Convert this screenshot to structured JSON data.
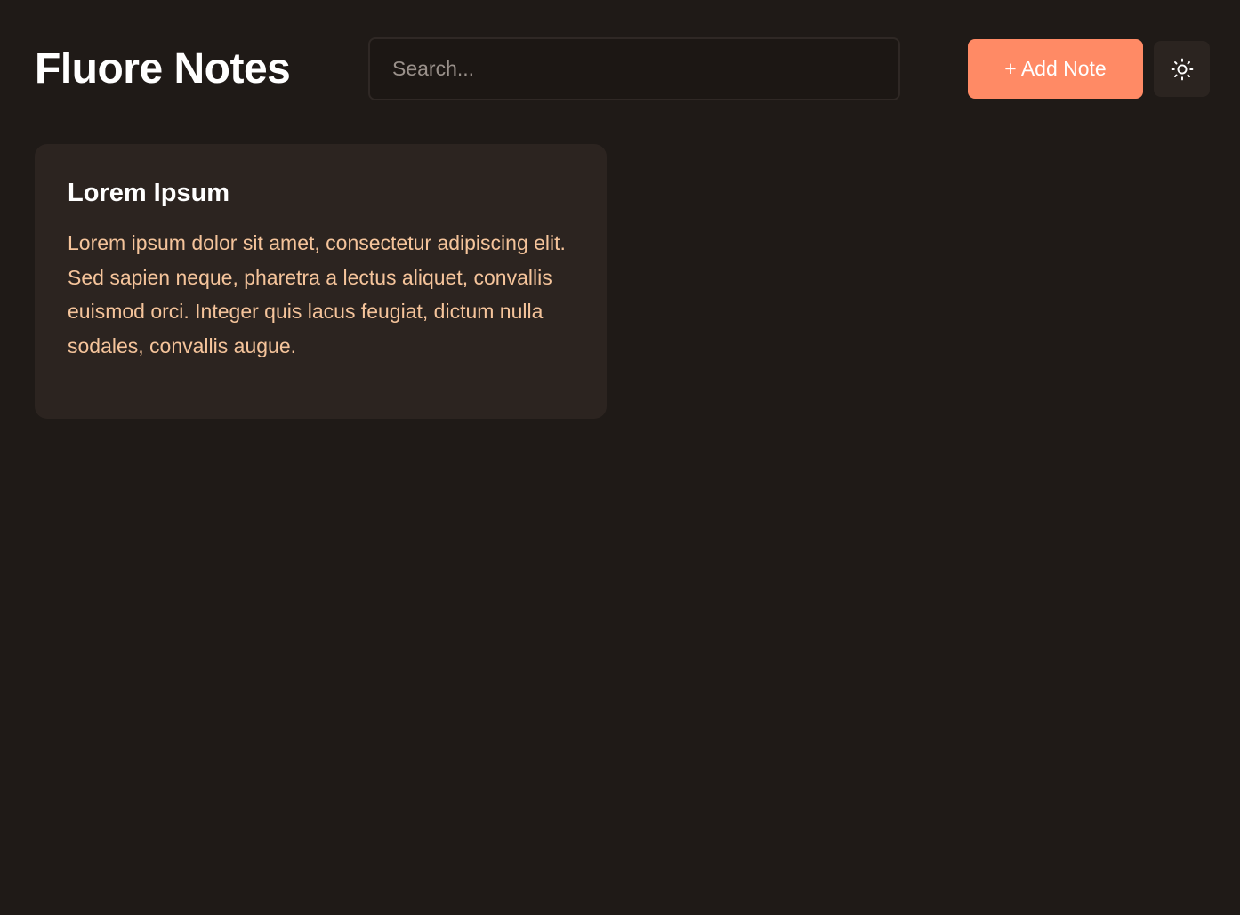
{
  "app": {
    "title": "Fluore Notes"
  },
  "search": {
    "placeholder": "Search...",
    "value": ""
  },
  "toolbar": {
    "add_note_label": "+ Add Note",
    "theme_toggle_icon": "sun-icon"
  },
  "notes": [
    {
      "title": "Lorem Ipsum",
      "body": "Lorem ipsum dolor sit amet, consectetur adipiscing elit. Sed sapien neque, pharetra a lectus aliquet, convallis euismod orci. Integer quis lacus feugiat, dictum nulla sodales, convallis augue."
    }
  ],
  "colors": {
    "background": "#1f1a17",
    "accent": "#ff8a65",
    "card_background": "#2c2420",
    "note_body_text": "#f5c49b"
  }
}
